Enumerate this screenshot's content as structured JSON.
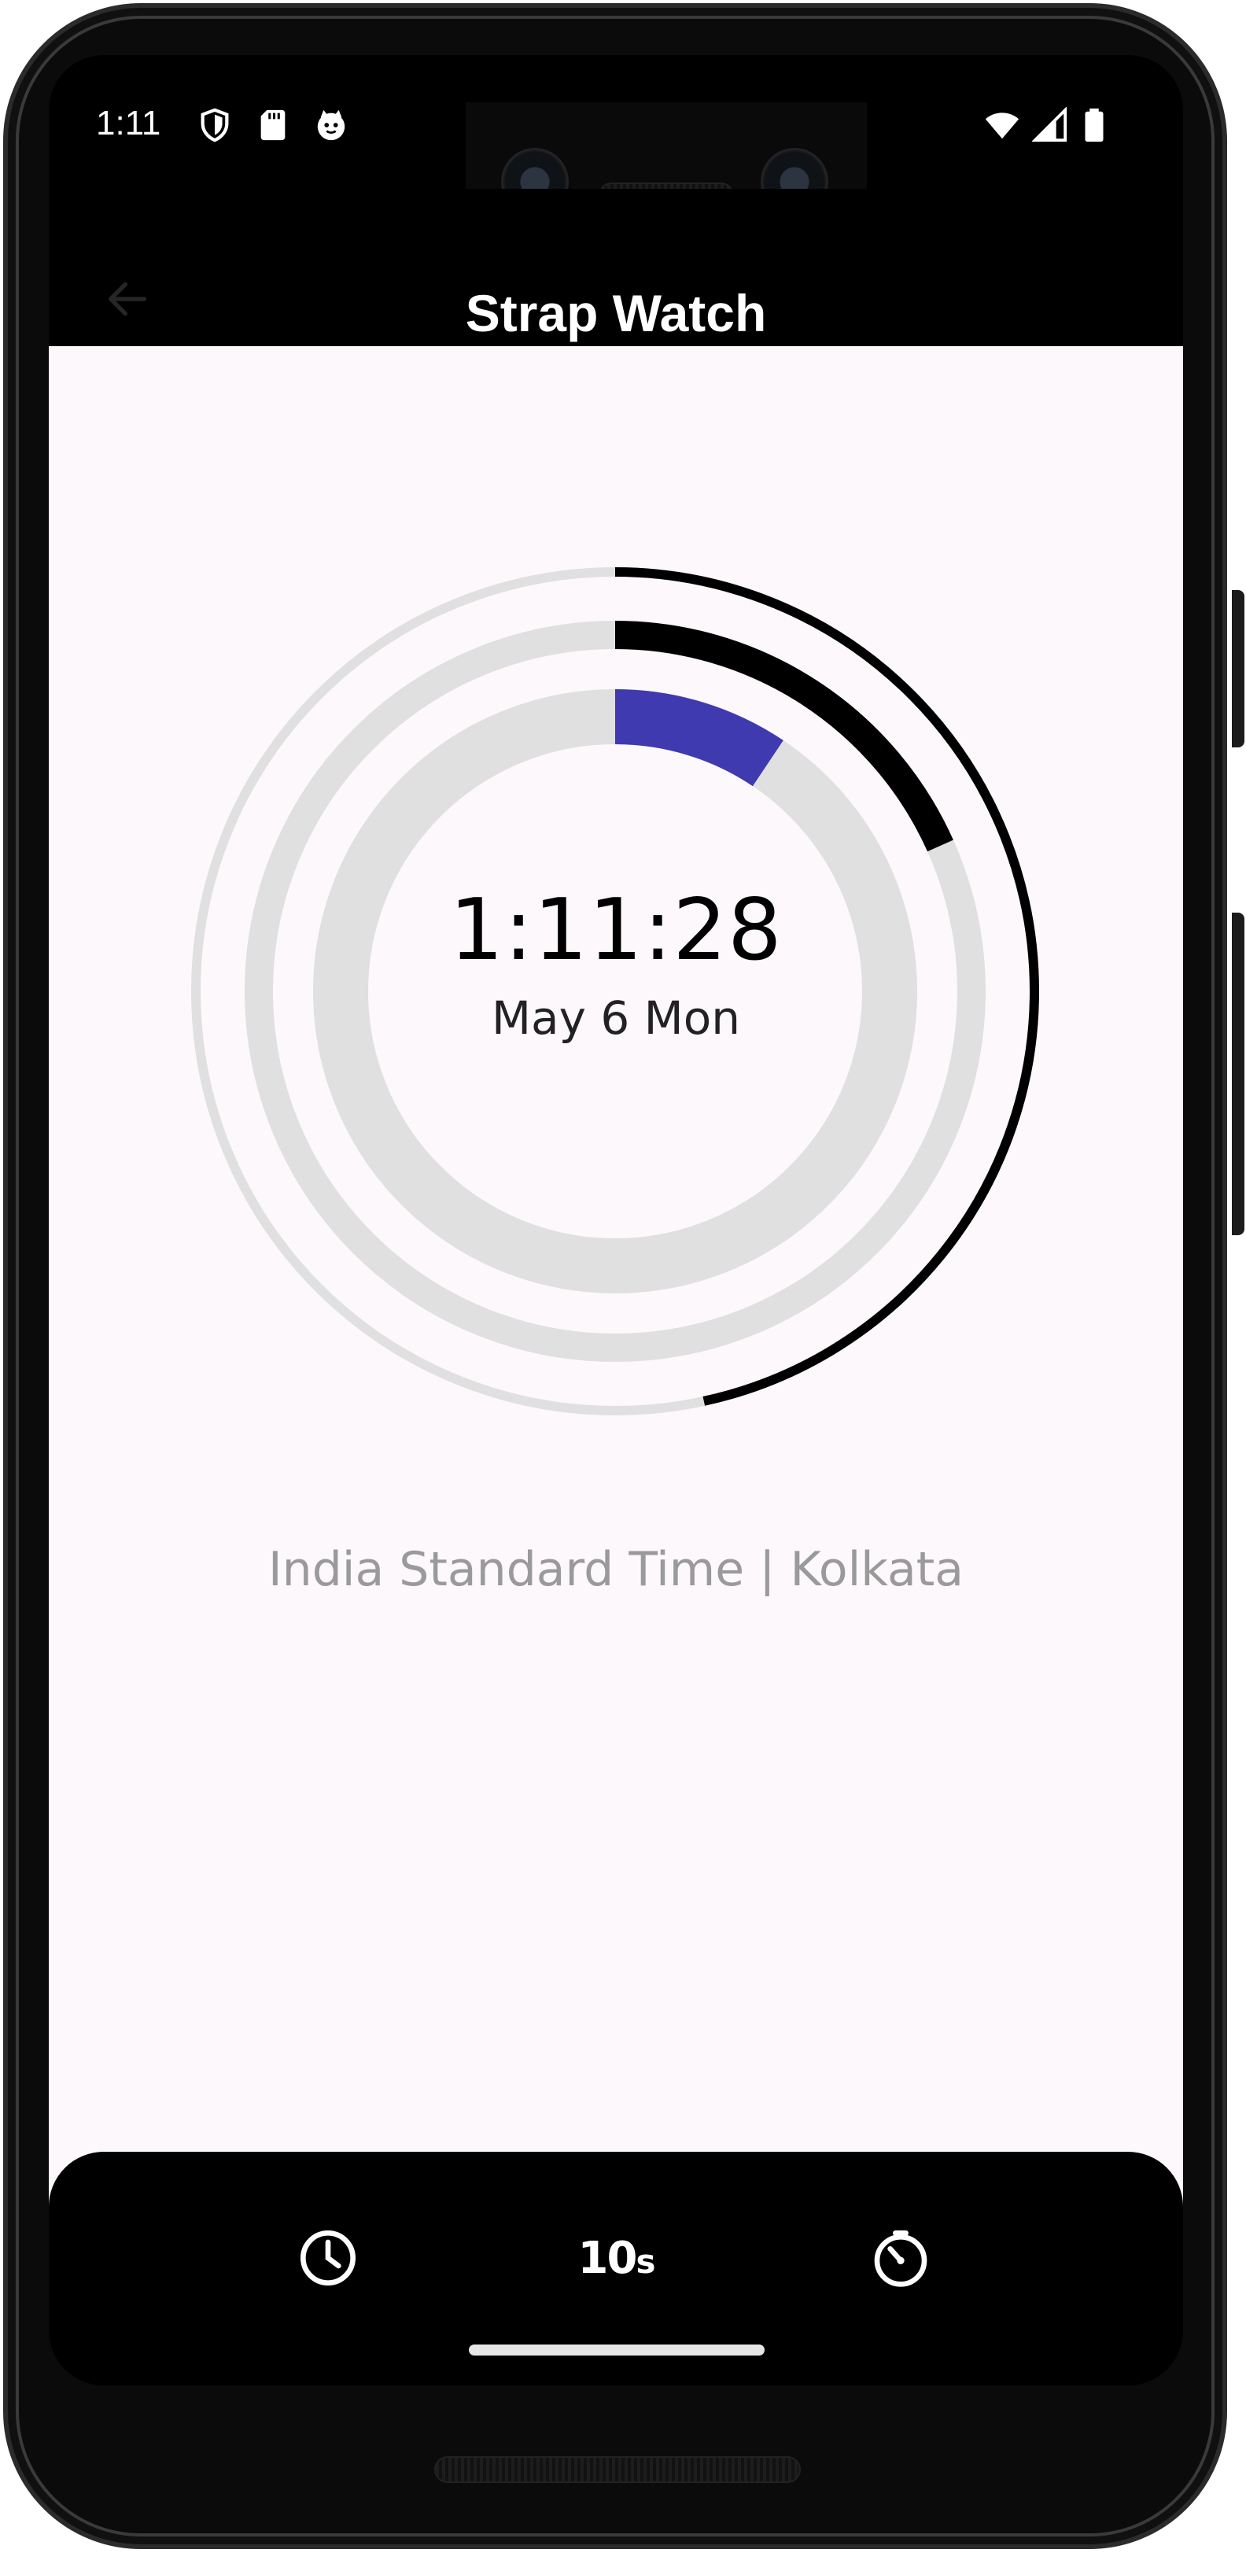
{
  "status_bar": {
    "time": "1:11",
    "left_icons": [
      "shield-icon",
      "sd-card-icon",
      "cat-face-icon"
    ],
    "right_icons": [
      "wifi-icon",
      "signal-icon",
      "battery-icon"
    ]
  },
  "app_bar": {
    "title": "Strap Watch",
    "back_icon": "back-arrow-icon"
  },
  "clock": {
    "time": "1:11:28",
    "date": "May 6 Mon",
    "timezone": "India Standard Time | Kolkata",
    "rings": {
      "outer": {
        "progress": 0.466,
        "track_color": "#e0e0e0",
        "fill_color": "#000000"
      },
      "middle": {
        "progress": 0.183,
        "track_color": "#e0e0e0",
        "fill_color": "#000000"
      },
      "inner": {
        "progress": 0.094,
        "track_color": "#e0e0e0",
        "fill_color": "#3f3ab0"
      }
    }
  },
  "bottom_nav": {
    "items": [
      {
        "icon": "clock-icon"
      },
      {
        "label": "10",
        "suffix": "s",
        "icon": "ten-seconds-icon"
      },
      {
        "icon": "timer-icon"
      }
    ]
  },
  "colors": {
    "accent": "#3f3ab0",
    "background": "#fcf8fc",
    "bar": "#000000"
  }
}
